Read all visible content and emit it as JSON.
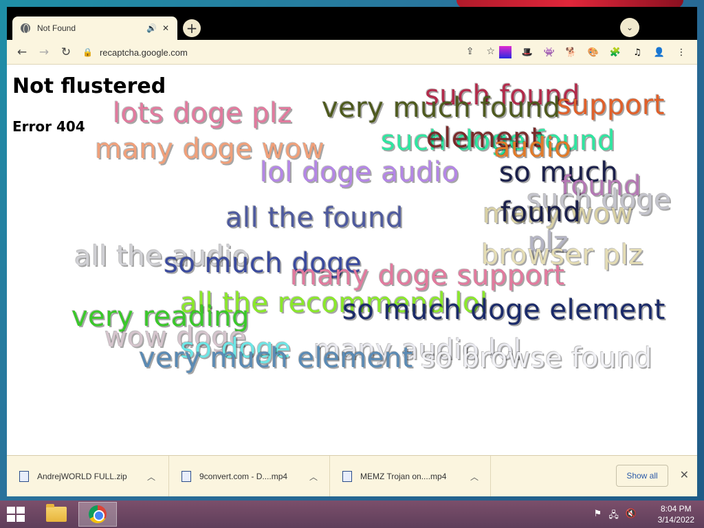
{
  "browser": {
    "tab_title": "Not Found",
    "new_tab": "+",
    "url": "recaptcha.google.com",
    "nav": {
      "back": "←",
      "forward": "→",
      "reload": "↻"
    }
  },
  "page": {
    "heading": "Not flustered",
    "subheading": "Error 404",
    "doge_texts": [
      {
        "text": "such found",
        "color": "#b22a4a"
      },
      {
        "text": "very much found",
        "color": "#4e5a1e"
      },
      {
        "text": "support",
        "color": "#e0602a"
      },
      {
        "text": "lots doge plz",
        "color": "#e27a9e"
      },
      {
        "text": "such doge found",
        "color": "#2ee6a0"
      },
      {
        "text": "element",
        "color": "#7a2a2a"
      },
      {
        "text": "audio",
        "color": "#e07a2a"
      },
      {
        "text": "many doge wow",
        "color": "#f0a07a"
      },
      {
        "text": "lol doge audio",
        "color": "#b486e6"
      },
      {
        "text": "so much",
        "color": "#1a1f4a"
      },
      {
        "text": "found",
        "color": "#b478b4"
      },
      {
        "text": "such doge",
        "color": "#c4c4cc"
      },
      {
        "text": "all the found",
        "color": "#4e5a9e"
      },
      {
        "text": "many wow",
        "color": "#d8d0a4"
      },
      {
        "text": "found",
        "color": "#1a1f4a"
      },
      {
        "text": "plz",
        "color": "#b4b4c4"
      },
      {
        "text": "all the audio",
        "color": "#d0d0d4"
      },
      {
        "text": "browser plz",
        "color": "#e4dcb4"
      },
      {
        "text": "so much doge",
        "color": "#3a4a9e"
      },
      {
        "text": "many doge support",
        "color": "#e27a9e"
      },
      {
        "text": "all the recommend lol",
        "color": "#8ae82a"
      },
      {
        "text": "very reading",
        "color": "#3ac82a"
      },
      {
        "text": "so much doge element",
        "color": "#1a2a6a"
      },
      {
        "text": "wow doge",
        "color": "#d4c4cc"
      },
      {
        "text": "so doge",
        "color": "#6ee6e6"
      },
      {
        "text": "many audio lol",
        "color": "#e8e8ee"
      },
      {
        "text": "very much element",
        "color": "#5a8ab4"
      },
      {
        "text": "so browse found",
        "color": "#f0f0f4"
      }
    ]
  },
  "downloads": {
    "items": [
      {
        "name": "AndrejWORLD FULL.zip"
      },
      {
        "name": "9convert.com - D....mp4"
      },
      {
        "name": "MEMZ Trojan on....mp4"
      }
    ],
    "show_all": "Show all",
    "close": "✕"
  },
  "taskbar": {
    "time": "8:04 PM",
    "date": "3/14/2022"
  }
}
